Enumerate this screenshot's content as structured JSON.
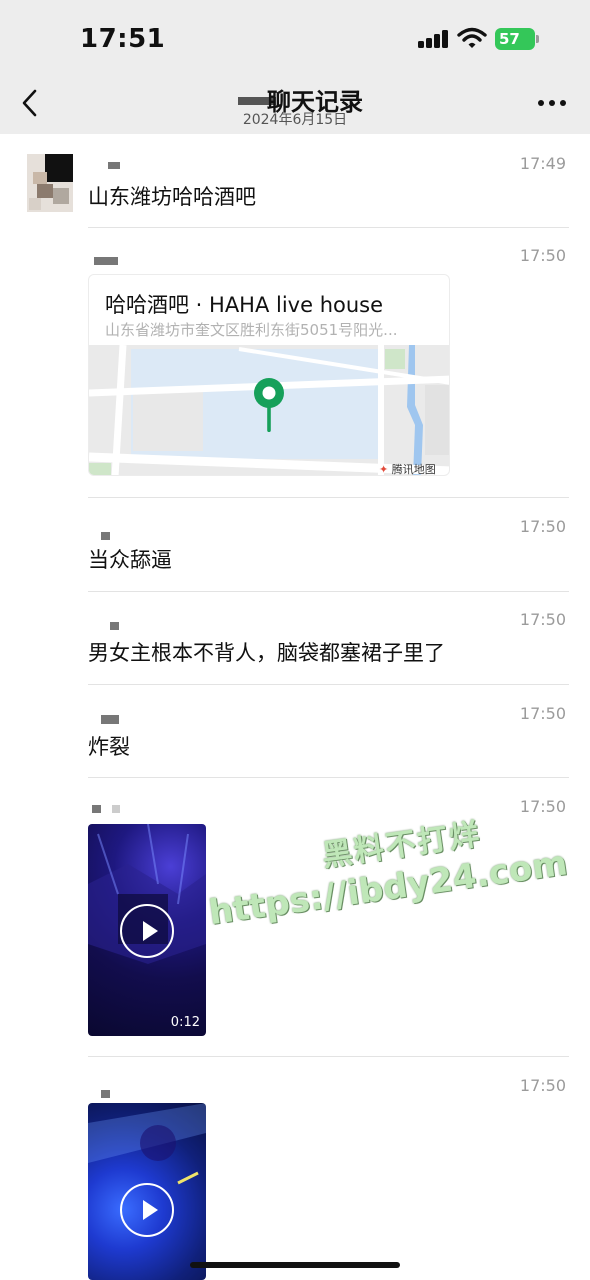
{
  "status_bar": {
    "time": "17:51",
    "battery": "57"
  },
  "nav": {
    "title": "聊天记录",
    "date": "2024年6月15日"
  },
  "messages": [
    {
      "type": "text",
      "time": "17:49",
      "text": "山东潍坊哈哈酒吧"
    },
    {
      "type": "location",
      "time": "17:50",
      "title": "哈哈酒吧 · HAHA live house",
      "address": "山东省潍坊市奎文区胜利东街5051号阳光...",
      "map_provider": "腾讯地图"
    },
    {
      "type": "text",
      "time": "17:50",
      "text": "当众舔逼"
    },
    {
      "type": "text",
      "time": "17:50",
      "text": "男女主根本不背人，脑袋都塞裙子里了"
    },
    {
      "type": "text",
      "time": "17:50",
      "text": "炸裂"
    },
    {
      "type": "video",
      "time": "17:50",
      "duration": "0:12"
    },
    {
      "type": "video",
      "time": "17:50"
    }
  ],
  "watermark": {
    "line1": "黑料不打烊",
    "line2": "https://ibdy24.com"
  },
  "icons": [
    "back-arrow-icon",
    "more-dots-icon",
    "signal-icon",
    "wifi-icon",
    "battery-icon",
    "location-pin-icon",
    "play-icon"
  ],
  "colors": {
    "topbar": "#ededed",
    "battery": "#34c759",
    "pin": "#16a05a",
    "timestamp": "#9b9b9b"
  }
}
